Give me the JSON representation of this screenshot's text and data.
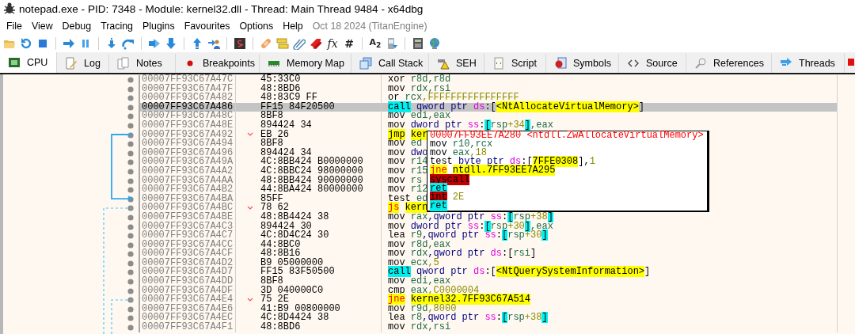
{
  "window": {
    "title": "notepad.exe - PID: 7348 - Module: kernel32.dll - Thread: Main Thread 9484 - x64dbg"
  },
  "menu": [
    "File",
    "View",
    "Debug",
    "Tracing",
    "Plugins",
    "Favourites",
    "Options",
    "Help"
  ],
  "build_info": "Oct 18 2024 (TitanEngine)",
  "toolbar_glyphs": [
    "fx",
    "#",
    "A$_{2}$"
  ],
  "tabs": [
    {
      "label": "CPU",
      "selected": true
    },
    {
      "label": "Log",
      "selected": false
    },
    {
      "label": "Notes",
      "selected": false
    },
    {
      "label": "Breakpoints",
      "selected": false
    },
    {
      "label": "Memory Map",
      "selected": false
    },
    {
      "label": "Call Stack",
      "selected": false
    },
    {
      "label": "SEH",
      "selected": false
    },
    {
      "label": "Script",
      "selected": false
    },
    {
      "label": "Symbols",
      "selected": false
    },
    {
      "label": "Source",
      "selected": false
    },
    {
      "label": "References",
      "selected": false
    },
    {
      "label": "Threads",
      "selected": false
    }
  ],
  "disassembly": [
    {
      "address": "00007FF93C67A47C",
      "bytes": "45:33C0",
      "selected": false,
      "asm": [
        {
          "kind": "mnemonic",
          "text": "xor"
        },
        {
          "kind": "register",
          "text": "r8d"
        },
        {
          "kind": "register",
          "text": ",r8d"
        }
      ]
    },
    {
      "address": "00007FF93C67A47F",
      "bytes": "48:8BD6",
      "selected": false,
      "asm": [
        {
          "kind": "mnemonic",
          "text": "mov"
        },
        {
          "kind": "register",
          "text": "rdx"
        },
        {
          "kind": "register",
          "text": ",rsi"
        }
      ]
    },
    {
      "address": "00007FF93C67A482",
      "bytes": "48:83C9 FF",
      "selected": false,
      "asm": [
        {
          "kind": "mnemonic",
          "text": "or"
        },
        {
          "kind": "register",
          "text": "rcx"
        },
        {
          "kind": "number",
          "text": ",FFFFFFFFFFFFFFFF"
        }
      ]
    },
    {
      "address": "00007FF93C67A486",
      "bytes": "FF15 84F20500",
      "selected": true,
      "asm": [
        {
          "kind": "call",
          "text": "call"
        },
        {
          "kind": "size",
          "text": "qword ptr"
        },
        {
          "kind": "segment",
          "text": "ds"
        },
        {
          "kind": "plain",
          "text": ":["
        },
        {
          "kind": "symbol",
          "text": "<NtAllocateVirtualMemory>"
        },
        {
          "kind": "plain",
          "text": "]"
        }
      ]
    },
    {
      "address": "00007FF93C67A48C",
      "bytes": "8BF8",
      "selected": false,
      "asm": [
        {
          "kind": "mnemonic",
          "text": "mov"
        },
        {
          "kind": "register",
          "text": "edi"
        },
        {
          "kind": "register",
          "text": ",eax"
        }
      ]
    },
    {
      "address": "00007FF93C67A48E",
      "bytes": "894424 34",
      "selected": false,
      "asm": [
        {
          "kind": "mnemonic",
          "text": "mov"
        },
        {
          "kind": "size",
          "text": "dword ptr"
        },
        {
          "kind": "segment",
          "text": "ss"
        },
        {
          "kind": "plain",
          "text": ":"
        },
        {
          "kind": "bracket",
          "text": "["
        },
        {
          "kind": "register",
          "text": "rsp"
        },
        {
          "kind": "number",
          "text": "+34"
        },
        {
          "kind": "bracket",
          "text": "]"
        },
        {
          "kind": "register",
          "text": ",eax"
        }
      ]
    },
    {
      "address": "00007FF93C67A492",
      "bytes": "EB 26",
      "selected": false,
      "arrow": {
        "kind": "start"
      },
      "asm": [
        {
          "kind": "jump",
          "text": "jmp"
        },
        {
          "kind": "symbol",
          "text": "ker"
        }
      ]
    },
    {
      "address": "00007FF93C67A494",
      "bytes": "8BF8",
      "selected": false,
      "asm": [
        {
          "kind": "mnemonic",
          "text": "mov"
        },
        {
          "kind": "register",
          "text": "ed"
        }
      ]
    },
    {
      "address": "00007FF93C67A496",
      "bytes": "894424 34",
      "selected": false,
      "asm": [
        {
          "kind": "mnemonic",
          "text": "mov"
        },
        {
          "kind": "size",
          "text": "dwo"
        }
      ]
    },
    {
      "address": "00007FF93C67A49A",
      "bytes": "4C:8BB424 B0000000",
      "selected": false,
      "asm": [
        {
          "kind": "mnemonic",
          "text": "mov"
        },
        {
          "kind": "register",
          "text": "r14"
        }
      ]
    },
    {
      "address": "00007FF93C67A4A2",
      "bytes": "4C:8BBC24 98000000",
      "selected": false,
      "asm": [
        {
          "kind": "mnemonic",
          "text": "mov"
        },
        {
          "kind": "register",
          "text": "r15"
        }
      ]
    },
    {
      "address": "00007FF93C67A4AA",
      "bytes": "48:8BB424 90000000",
      "selected": false,
      "asm": [
        {
          "kind": "mnemonic",
          "text": "mov"
        },
        {
          "kind": "register",
          "text": "rs"
        }
      ]
    },
    {
      "address": "00007FF93C67A4B2",
      "bytes": "44:8BA424 80000000",
      "selected": false,
      "asm": [
        {
          "kind": "mnemonic",
          "text": "mov"
        },
        {
          "kind": "register",
          "text": "r12"
        }
      ]
    },
    {
      "address": "00007FF93C67A4BA",
      "bytes": "85FF",
      "selected": false,
      "arrow": {
        "kind": "end"
      },
      "asm": [
        {
          "kind": "mnemonic",
          "text": "test"
        },
        {
          "kind": "register",
          "text": "ed"
        }
      ]
    },
    {
      "address": "00007FF93C67A4BC",
      "bytes": "78 62",
      "selected": false,
      "arrow": {
        "kind": "start",
        "dashed": true
      },
      "asm": [
        {
          "kind": "branch",
          "text": "js"
        },
        {
          "kind": "symbol",
          "text": "kern"
        }
      ]
    },
    {
      "address": "00007FF93C67A4BE",
      "bytes": "48:8B4424 38",
      "selected": false,
      "asm": [
        {
          "kind": "mnemonic",
          "text": "mov"
        },
        {
          "kind": "register",
          "text": "rax"
        },
        {
          "kind": "size",
          "text": ",qword ptr"
        },
        {
          "kind": "segment",
          "text": "ss"
        },
        {
          "kind": "plain",
          "text": ":"
        },
        {
          "kind": "bracket",
          "text": "["
        },
        {
          "kind": "register",
          "text": "rsp"
        },
        {
          "kind": "number",
          "text": "+38"
        },
        {
          "kind": "bracket",
          "text": "]"
        }
      ]
    },
    {
      "address": "00007FF93C67A4C3",
      "bytes": "894424 30",
      "selected": false,
      "asm": [
        {
          "kind": "mnemonic",
          "text": "mov"
        },
        {
          "kind": "size",
          "text": "dword ptr"
        },
        {
          "kind": "segment",
          "text": "ss"
        },
        {
          "kind": "plain",
          "text": ":"
        },
        {
          "kind": "bracket",
          "text": "["
        },
        {
          "kind": "register",
          "text": "rsp"
        },
        {
          "kind": "number",
          "text": "+30"
        },
        {
          "kind": "bracket",
          "text": "]"
        },
        {
          "kind": "register",
          "text": ",eax"
        }
      ]
    },
    {
      "address": "00007FF93C67A4C7",
      "bytes": "4C:8D4C24 30",
      "selected": false,
      "asm": [
        {
          "kind": "mnemonic",
          "text": "lea"
        },
        {
          "kind": "register",
          "text": "r9"
        },
        {
          "kind": "size",
          "text": ",qword ptr"
        },
        {
          "kind": "segment",
          "text": "ss"
        },
        {
          "kind": "plain",
          "text": ":"
        },
        {
          "kind": "bracket",
          "text": "["
        },
        {
          "kind": "register",
          "text": "rsp"
        },
        {
          "kind": "number",
          "text": "+30"
        },
        {
          "kind": "bracket",
          "text": "]"
        }
      ]
    },
    {
      "address": "00007FF93C67A4CC",
      "bytes": "44:8BC0",
      "selected": false,
      "asm": [
        {
          "kind": "mnemonic",
          "text": "mov"
        },
        {
          "kind": "register",
          "text": "r8d"
        },
        {
          "kind": "register",
          "text": ",eax"
        }
      ]
    },
    {
      "address": "00007FF93C67A4CF",
      "bytes": "48:8B16",
      "selected": false,
      "asm": [
        {
          "kind": "mnemonic",
          "text": "mov"
        },
        {
          "kind": "register",
          "text": "rdx"
        },
        {
          "kind": "size",
          "text": ",qword ptr"
        },
        {
          "kind": "segment",
          "text": "ds"
        },
        {
          "kind": "plain",
          "text": ":["
        },
        {
          "kind": "register",
          "text": "rsi"
        },
        {
          "kind": "plain",
          "text": "]"
        }
      ]
    },
    {
      "address": "00007FF93C67A4D2",
      "bytes": "B9 05000000",
      "selected": false,
      "asm": [
        {
          "kind": "mnemonic",
          "text": "mov"
        },
        {
          "kind": "register",
          "text": "ecx"
        },
        {
          "kind": "number",
          "text": ",5"
        }
      ]
    },
    {
      "address": "00007FF93C67A4D7",
      "bytes": "FF15 83F50500",
      "selected": false,
      "asm": [
        {
          "kind": "call",
          "text": "call"
        },
        {
          "kind": "size",
          "text": "qword ptr"
        },
        {
          "kind": "segment",
          "text": "ds"
        },
        {
          "kind": "plain",
          "text": ":["
        },
        {
          "kind": "symbol",
          "text": "<NtQuerySystemInformation>"
        },
        {
          "kind": "plain",
          "text": "]"
        }
      ]
    },
    {
      "address": "00007FF93C67A4DD",
      "bytes": "8BF8",
      "selected": false,
      "asm": [
        {
          "kind": "mnemonic",
          "text": "mov"
        },
        {
          "kind": "register",
          "text": "edi"
        },
        {
          "kind": "register",
          "text": ",eax"
        }
      ]
    },
    {
      "address": "00007FF93C67A4DF",
      "bytes": "3D 040000C0",
      "selected": false,
      "asm": [
        {
          "kind": "mnemonic",
          "text": "cmp"
        },
        {
          "kind": "register",
          "text": "eax"
        },
        {
          "kind": "number",
          "text": ",C0000004"
        }
      ]
    },
    {
      "address": "00007FF93C67A4E4",
      "bytes": "75 2E",
      "selected": false,
      "arrow": {
        "kind": "start",
        "dashed": true
      },
      "asm": [
        {
          "kind": "branch",
          "text": "jne"
        },
        {
          "kind": "symbol",
          "text": "kernel32.7FF93C67A514"
        }
      ]
    },
    {
      "address": "00007FF93C67A4E6",
      "bytes": "41:B9 00800000",
      "selected": false,
      "asm": [
        {
          "kind": "mnemonic",
          "text": "mov"
        },
        {
          "kind": "register",
          "text": "r9d"
        },
        {
          "kind": "number",
          "text": ",8000"
        }
      ]
    },
    {
      "address": "00007FF93C67A4EC",
      "bytes": "4C:8D4424 38",
      "selected": false,
      "asm": [
        {
          "kind": "mnemonic",
          "text": "lea"
        },
        {
          "kind": "register",
          "text": "r8"
        },
        {
          "kind": "size",
          "text": ",qword ptr"
        },
        {
          "kind": "segment",
          "text": "ss"
        },
        {
          "kind": "plain",
          "text": ":"
        },
        {
          "kind": "bracket",
          "text": "["
        },
        {
          "kind": "register",
          "text": "rsp"
        },
        {
          "kind": "number",
          "text": "+38"
        },
        {
          "kind": "bracket",
          "text": "]"
        }
      ]
    },
    {
      "address": "00007FF93C67A4F1",
      "bytes": "48:8BD6",
      "selected": false,
      "asm": [
        {
          "kind": "mnemonic",
          "text": "mov"
        },
        {
          "kind": "register",
          "text": "rdx"
        },
        {
          "kind": "register",
          "text": ",rsi"
        }
      ]
    }
  ],
  "preview_popup": {
    "header": "00007FF93EE7A280 <ntdll.ZwAllocateVirtualMemory>",
    "lines": [
      [
        {
          "kind": "mnemonic",
          "text": "mov"
        },
        {
          "kind": "register",
          "text": "r10"
        },
        {
          "kind": "register",
          "text": ",rcx"
        }
      ],
      [
        {
          "kind": "mnemonic",
          "text": "mov"
        },
        {
          "kind": "register",
          "text": "eax"
        },
        {
          "kind": "number",
          "text": ",18"
        }
      ],
      [
        {
          "kind": "mnemonic",
          "text": "test"
        },
        {
          "kind": "size",
          "text": "byte ptr"
        },
        {
          "kind": "segment",
          "text": "ds"
        },
        {
          "kind": "plain",
          "text": ":["
        },
        {
          "kind": "symbol",
          "text": "7FFE0308"
        },
        {
          "kind": "plain",
          "text": "],"
        },
        {
          "kind": "number",
          "text": "1"
        }
      ],
      [
        {
          "kind": "branch",
          "text": "jne"
        },
        {
          "kind": "symbol",
          "text": "ntdll.7FF93EE7A295"
        }
      ],
      [
        {
          "kind": "trap",
          "text": "syscall"
        }
      ],
      [
        {
          "kind": "call",
          "text": "ret"
        }
      ],
      [
        {
          "kind": "trap",
          "text": "int"
        },
        {
          "kind": "number",
          "text": "2E"
        }
      ],
      [
        {
          "kind": "call",
          "text": "ret"
        }
      ]
    ]
  }
}
